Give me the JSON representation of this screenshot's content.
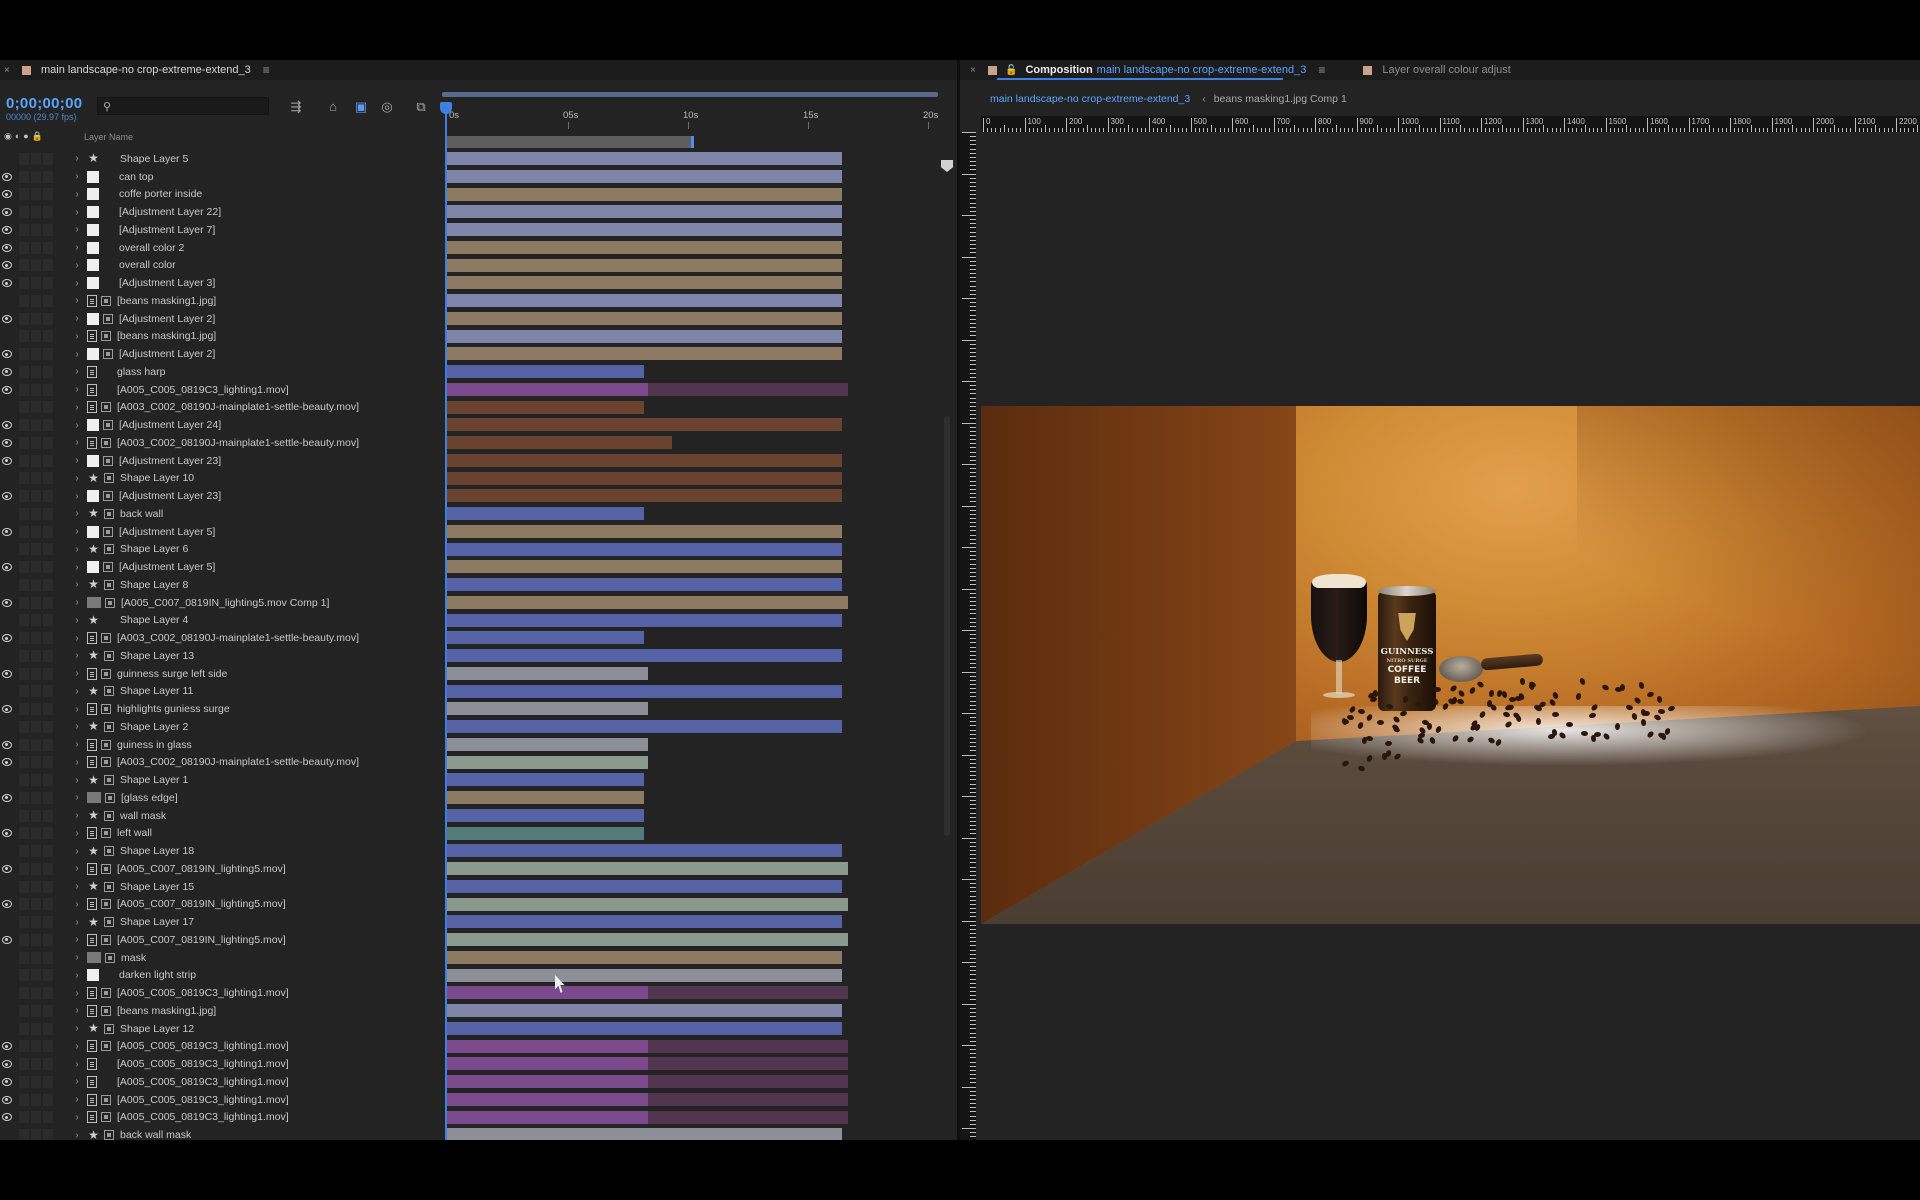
{
  "colors": {
    "accent_blue": "#5aa4ff",
    "playhead": "#3f7fe0",
    "panel_bg": "#232323"
  },
  "timeline": {
    "tab_title": "main landscape-no crop-extreme-extend_3",
    "timecode": "0;00;00;00",
    "fps": "00000 (29.97 fps)",
    "search_placeholder": "",
    "column_label": "Layer Name",
    "ruler_labels": [
      "0s",
      "05s",
      "10s",
      "15s",
      "20s"
    ],
    "layers": [
      {
        "name": "Shape Layer 5",
        "type": "star",
        "vis": false,
        "fx": false,
        "bars": [
          [
            "lav",
            0,
            1
          ]
        ]
      },
      {
        "name": "can top",
        "type": "solid",
        "vis": true,
        "fx": false,
        "bars": [
          [
            "lav",
            0,
            1
          ]
        ]
      },
      {
        "name": "coffe porter inside",
        "type": "solid",
        "vis": true,
        "fx": false,
        "bars": [
          [
            "tan",
            0,
            1
          ]
        ]
      },
      {
        "name": "[Adjustment Layer 22]",
        "type": "solid",
        "vis": true,
        "fx": false,
        "bars": [
          [
            "lav",
            0,
            1
          ]
        ]
      },
      {
        "name": "[Adjustment Layer 7]",
        "type": "solid",
        "vis": true,
        "fx": false,
        "bars": [
          [
            "lav",
            0,
            1
          ]
        ]
      },
      {
        "name": "overall color 2",
        "type": "solid",
        "vis": true,
        "fx": false,
        "bars": [
          [
            "tan",
            0,
            1
          ]
        ]
      },
      {
        "name": "overall color",
        "type": "solid",
        "vis": true,
        "fx": false,
        "bars": [
          [
            "tan",
            0,
            1
          ]
        ]
      },
      {
        "name": "[Adjustment Layer 3]",
        "type": "solid",
        "vis": true,
        "fx": false,
        "bars": [
          [
            "tan",
            0,
            1
          ]
        ]
      },
      {
        "name": "[beans masking1.jpg]",
        "type": "footage",
        "vis": false,
        "fx": true,
        "bars": [
          [
            "lav",
            0,
            1
          ]
        ]
      },
      {
        "name": "[Adjustment Layer 2]",
        "type": "solid",
        "vis": true,
        "fx": true,
        "bars": [
          [
            "tan",
            0,
            1
          ]
        ]
      },
      {
        "name": "[beans masking1.jpg]",
        "type": "footage",
        "vis": false,
        "fx": true,
        "bars": [
          [
            "lav",
            0,
            1
          ]
        ]
      },
      {
        "name": "[Adjustment Layer 2]",
        "type": "solid",
        "vis": true,
        "fx": true,
        "bars": [
          [
            "tan",
            0,
            1
          ]
        ]
      },
      {
        "name": "glass harp",
        "type": "footage",
        "vis": true,
        "fx": false,
        "bars": [
          [
            "blue",
            0,
            0.5
          ]
        ]
      },
      {
        "name": "[A005_C005_0819C3_lighting1.mov]",
        "type": "footage",
        "vis": true,
        "fx": false,
        "bars": [
          [
            "purple",
            0,
            0.51
          ],
          [
            "purpled",
            0.51,
            1.015
          ]
        ]
      },
      {
        "name": "[A003_C002_08190J-mainplate1-settle-beauty.mov]",
        "type": "footage",
        "vis": false,
        "fx": true,
        "bars": [
          [
            "brown",
            0,
            0.5
          ]
        ]
      },
      {
        "name": "[Adjustment Layer 24]",
        "type": "solid",
        "vis": true,
        "fx": true,
        "bars": [
          [
            "brown",
            0,
            1
          ]
        ]
      },
      {
        "name": "[A003_C002_08190J-mainplate1-settle-beauty.mov]",
        "type": "footage",
        "vis": true,
        "fx": true,
        "bars": [
          [
            "brown",
            0,
            0.57
          ]
        ]
      },
      {
        "name": "[Adjustment Layer 23]",
        "type": "solid",
        "vis": true,
        "fx": true,
        "bars": [
          [
            "brown",
            0,
            1
          ]
        ]
      },
      {
        "name": "Shape Layer 10",
        "type": "star",
        "vis": false,
        "fx": true,
        "bars": [
          [
            "brown",
            0,
            1
          ]
        ]
      },
      {
        "name": "[Adjustment Layer 23]",
        "type": "solid",
        "vis": true,
        "fx": true,
        "bars": [
          [
            "brown",
            0,
            1
          ]
        ]
      },
      {
        "name": "back wall",
        "type": "star",
        "vis": false,
        "fx": true,
        "bars": [
          [
            "blue",
            0,
            0.5
          ]
        ]
      },
      {
        "name": "[Adjustment Layer 5]",
        "type": "solid",
        "vis": true,
        "fx": true,
        "bars": [
          [
            "tan",
            0,
            1
          ]
        ]
      },
      {
        "name": "Shape Layer 6",
        "type": "star",
        "vis": false,
        "fx": true,
        "bars": [
          [
            "blue",
            0,
            1
          ]
        ]
      },
      {
        "name": "[Adjustment Layer 5]",
        "type": "solid",
        "vis": true,
        "fx": true,
        "bars": [
          [
            "tan",
            0,
            1
          ]
        ]
      },
      {
        "name": "Shape Layer 8",
        "type": "star",
        "vis": false,
        "fx": true,
        "bars": [
          [
            "blue",
            0,
            1
          ]
        ]
      },
      {
        "name": "[A005_C007_0819IN_lighting5.mov Comp 1]",
        "type": "precomp",
        "vis": true,
        "fx": true,
        "bars": [
          [
            "tan",
            0,
            1.015
          ]
        ]
      },
      {
        "name": "Shape Layer 4",
        "type": "star",
        "vis": false,
        "fx": false,
        "bars": [
          [
            "blue",
            0,
            1
          ]
        ]
      },
      {
        "name": "[A003_C002_08190J-mainplate1-settle-beauty.mov]",
        "type": "footage",
        "vis": true,
        "fx": true,
        "bars": [
          [
            "blue",
            0,
            0.5
          ]
        ]
      },
      {
        "name": "Shape Layer 13",
        "type": "star",
        "vis": false,
        "fx": true,
        "bars": [
          [
            "blue",
            0,
            1
          ]
        ]
      },
      {
        "name": "guinness surge left side",
        "type": "footage",
        "vis": true,
        "fx": true,
        "bars": [
          [
            "grey",
            0,
            0.51
          ]
        ]
      },
      {
        "name": "Shape Layer 11",
        "type": "star",
        "vis": false,
        "fx": true,
        "bars": [
          [
            "blue",
            0,
            1
          ]
        ]
      },
      {
        "name": "highlights guniess surge",
        "type": "footage",
        "vis": true,
        "fx": true,
        "bars": [
          [
            "grey",
            0,
            0.51
          ]
        ]
      },
      {
        "name": "Shape Layer 2",
        "type": "star",
        "vis": false,
        "fx": true,
        "bars": [
          [
            "blue",
            0,
            1
          ]
        ]
      },
      {
        "name": "guiness in glass",
        "type": "footage",
        "vis": true,
        "fx": true,
        "bars": [
          [
            "grey",
            0,
            0.51
          ]
        ]
      },
      {
        "name": "[A003_C002_08190J-mainplate1-settle-beauty.mov]",
        "type": "footage",
        "vis": true,
        "fx": true,
        "bars": [
          [
            "sage",
            0,
            0.51
          ]
        ]
      },
      {
        "name": "Shape Layer 1",
        "type": "star",
        "vis": false,
        "fx": true,
        "bars": [
          [
            "blue",
            0,
            0.5
          ]
        ]
      },
      {
        "name": "[glass edge]",
        "type": "precomp",
        "vis": true,
        "fx": true,
        "bars": [
          [
            "tan",
            0,
            0.5
          ]
        ]
      },
      {
        "name": "wall mask",
        "type": "star",
        "vis": false,
        "fx": true,
        "bars": [
          [
            "blue",
            0,
            0.5
          ]
        ]
      },
      {
        "name": "left wall",
        "type": "footage",
        "vis": true,
        "fx": true,
        "bars": [
          [
            "teal",
            0,
            0.5
          ]
        ]
      },
      {
        "name": "Shape Layer 18",
        "type": "star",
        "vis": false,
        "fx": true,
        "bars": [
          [
            "blue",
            0,
            1
          ]
        ]
      },
      {
        "name": "[A005_C007_0819IN_lighting5.mov]",
        "type": "footage",
        "vis": true,
        "fx": true,
        "bars": [
          [
            "sage",
            0,
            1.015
          ]
        ]
      },
      {
        "name": "Shape Layer 15",
        "type": "star",
        "vis": false,
        "fx": true,
        "bars": [
          [
            "blue",
            0,
            1
          ]
        ]
      },
      {
        "name": "[A005_C007_0819IN_lighting5.mov]",
        "type": "footage",
        "vis": true,
        "fx": true,
        "bars": [
          [
            "sage",
            0,
            1.015
          ]
        ]
      },
      {
        "name": "Shape Layer 17",
        "type": "star",
        "vis": false,
        "fx": true,
        "bars": [
          [
            "blue",
            0,
            1
          ]
        ]
      },
      {
        "name": "[A005_C007_0819IN_lighting5.mov]",
        "type": "footage",
        "vis": true,
        "fx": true,
        "bars": [
          [
            "sage",
            0,
            1.015
          ]
        ]
      },
      {
        "name": "mask",
        "type": "precomp",
        "vis": false,
        "fx": true,
        "bars": [
          [
            "tan",
            0,
            1
          ]
        ]
      },
      {
        "name": "darken light strip",
        "type": "solid",
        "vis": false,
        "fx": false,
        "bars": [
          [
            "grey",
            0,
            1
          ]
        ]
      },
      {
        "name": "[A005_C005_0819C3_lighting1.mov]",
        "type": "footage",
        "vis": false,
        "fx": true,
        "bars": [
          [
            "purple",
            0,
            0.51
          ],
          [
            "purpled",
            0.51,
            1.015
          ]
        ]
      },
      {
        "name": "[beans masking1.jpg]",
        "type": "footage",
        "vis": false,
        "fx": true,
        "bars": [
          [
            "lav",
            0,
            1
          ]
        ]
      },
      {
        "name": "Shape Layer 12",
        "type": "star",
        "vis": false,
        "fx": true,
        "bars": [
          [
            "blue",
            0,
            1
          ]
        ]
      },
      {
        "name": "[A005_C005_0819C3_lighting1.mov]",
        "type": "footage",
        "vis": true,
        "fx": true,
        "bars": [
          [
            "purple",
            0,
            0.51
          ],
          [
            "purpled",
            0.51,
            1.015
          ]
        ]
      },
      {
        "name": "[A005_C005_0819C3_lighting1.mov]",
        "type": "footage",
        "vis": true,
        "fx": false,
        "bars": [
          [
            "purple",
            0,
            0.51
          ],
          [
            "purpled",
            0.51,
            1.015
          ]
        ]
      },
      {
        "name": "[A005_C005_0819C3_lighting1.mov]",
        "type": "footage",
        "vis": true,
        "fx": false,
        "bars": [
          [
            "purple",
            0,
            0.51
          ],
          [
            "purpled",
            0.51,
            1.015
          ]
        ]
      },
      {
        "name": "[A005_C005_0819C3_lighting1.mov]",
        "type": "footage",
        "vis": true,
        "fx": true,
        "bars": [
          [
            "purple",
            0,
            0.51
          ],
          [
            "purpled",
            0.51,
            1.015
          ]
        ]
      },
      {
        "name": "[A005_C005_0819C3_lighting1.mov]",
        "type": "footage",
        "vis": true,
        "fx": true,
        "bars": [
          [
            "purple",
            0,
            0.51
          ],
          [
            "purpled",
            0.51,
            1.015
          ]
        ]
      },
      {
        "name": "back wall mask",
        "type": "star",
        "vis": false,
        "fx": true,
        "bars": [
          [
            "grey",
            0,
            1
          ]
        ]
      }
    ],
    "bar_colors": {
      "lav": "#7f85a8",
      "tan": "#8c7a62",
      "blue": "#5662a6",
      "purple": "#7a4a8c",
      "purpled": "#52354f",
      "brown": "#6a4330",
      "grey": "#8c8f98",
      "sage": "#8a9a8e",
      "teal": "#557a7a"
    }
  },
  "composition": {
    "tab_prefix": "Composition",
    "tab_name": "main landscape-no crop-extreme-extend_3",
    "layer_tab": "Layer  overall colour adjust",
    "breadcrumb_1": "main landscape-no crop-extreme-extend_3",
    "breadcrumb_2": "beans masking1.jpg Comp 1",
    "hruler_labels": [
      "0",
      "100",
      "200",
      "300",
      "400",
      "500",
      "600",
      "700",
      "800",
      "900",
      "1000",
      "1100",
      "1200",
      "1300",
      "1400",
      "1500",
      "1600",
      "1700",
      "1800",
      "1900",
      "2000",
      "2100",
      "2200"
    ],
    "can_text": [
      "GUINNESS",
      "NITRO SURGE",
      "COFFEE",
      "BEER"
    ]
  }
}
